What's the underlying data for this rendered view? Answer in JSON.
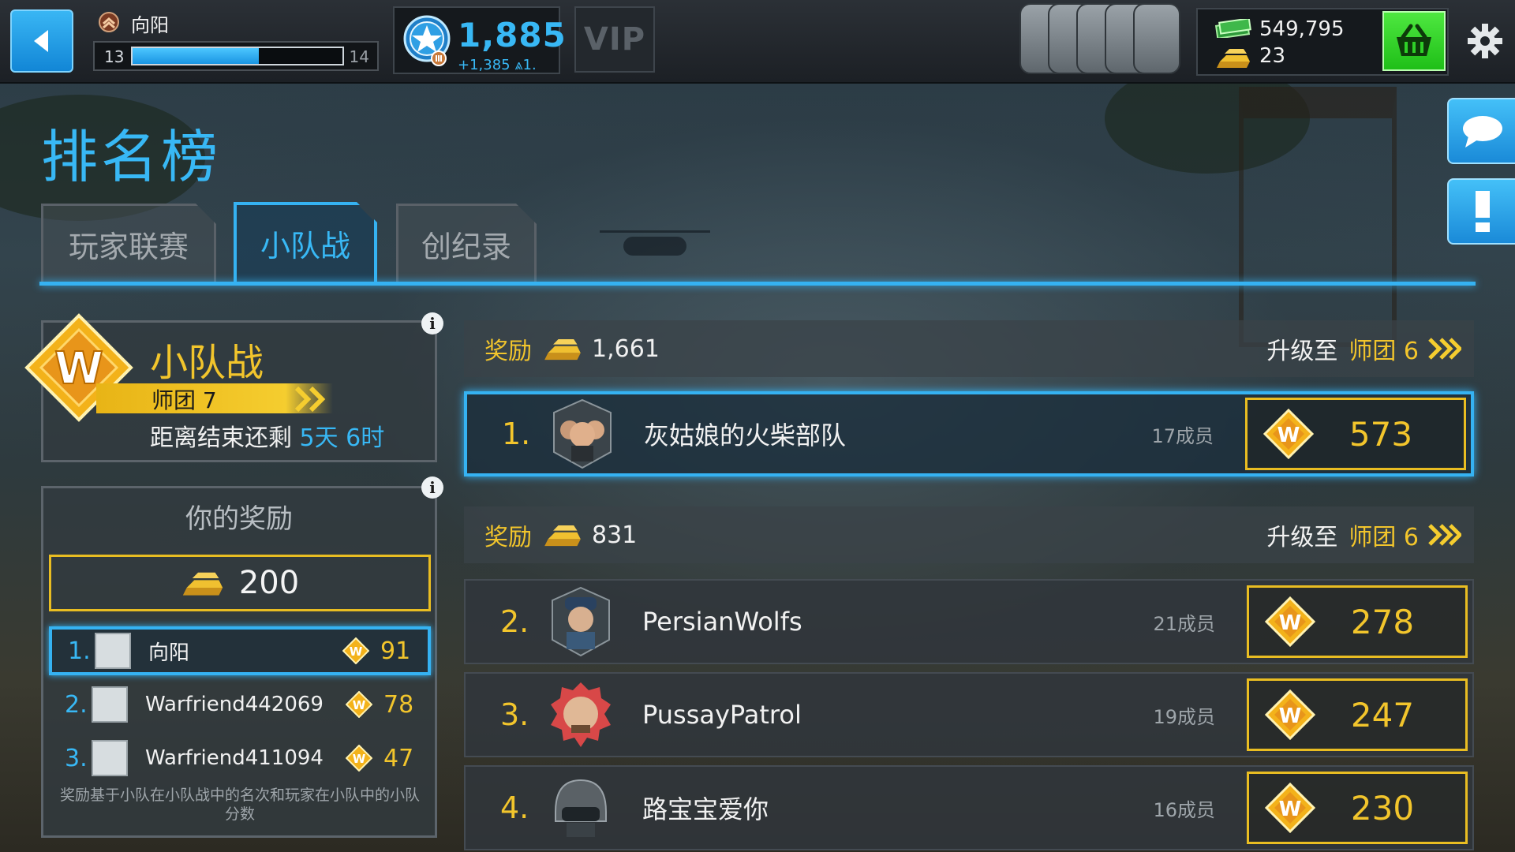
{
  "topbar": {
    "player_name": "向阳",
    "level_current": "13",
    "level_next": "14",
    "xp_fraction": 0.6,
    "medals": "1,885",
    "medals_gain": "+1,385 ⩓1.",
    "vip_label": "VIP",
    "cash": "549,795",
    "gold": "23"
  },
  "page": {
    "title": "排名榜",
    "tabs": [
      {
        "label": "玩家联赛",
        "active": false
      },
      {
        "label": "小队战",
        "active": true
      },
      {
        "label": "创纪录",
        "active": false
      }
    ]
  },
  "war_info": {
    "title": "小队战",
    "division": "师团 7",
    "remaining_label": "距离结束还剩",
    "remaining_value": "5天 6时"
  },
  "your_reward": {
    "title": "你的奖励",
    "amount": "200",
    "members": [
      {
        "rank": "1.",
        "name": "向阳",
        "score": "91",
        "highlight": true
      },
      {
        "rank": "2.",
        "name": "Warfriend442069",
        "score": "78",
        "highlight": false
      },
      {
        "rank": "3.",
        "name": "Warfriend411094",
        "score": "47",
        "highlight": false
      }
    ],
    "note": "奖励基于小队在小队战中的名次和玩家在小队中的小队分数"
  },
  "leaderboard": {
    "reward_bars": [
      {
        "label": "奖励",
        "amount": "1,661",
        "upgrade_label": "升级至",
        "division": "师团 6"
      },
      {
        "label": "奖励",
        "amount": "831",
        "upgrade_label": "升级至",
        "division": "师团 6"
      }
    ],
    "teams": [
      {
        "rank": "1.",
        "name": "灰姑娘的火柴部队",
        "members": "17成员",
        "score": "573",
        "highlight": true,
        "avatar": "soldier-trio-icon"
      },
      {
        "rank": "2.",
        "name": "PersianWolfs",
        "members": "21成员",
        "score": "278",
        "highlight": false,
        "avatar": "saluting-soldier-icon"
      },
      {
        "rank": "3.",
        "name": "PussayPatrol",
        "members": "19成员",
        "score": "247",
        "highlight": false,
        "avatar": "bald-soldier-icon"
      },
      {
        "rank": "4.",
        "name": "路宝宝爱你",
        "members": "16成员",
        "score": "230",
        "highlight": false,
        "avatar": "helmet-icon"
      }
    ]
  },
  "colors": {
    "accent_blue": "#35b2f2",
    "gold": "#f2c52c",
    "shop_green": "#2fd028"
  }
}
